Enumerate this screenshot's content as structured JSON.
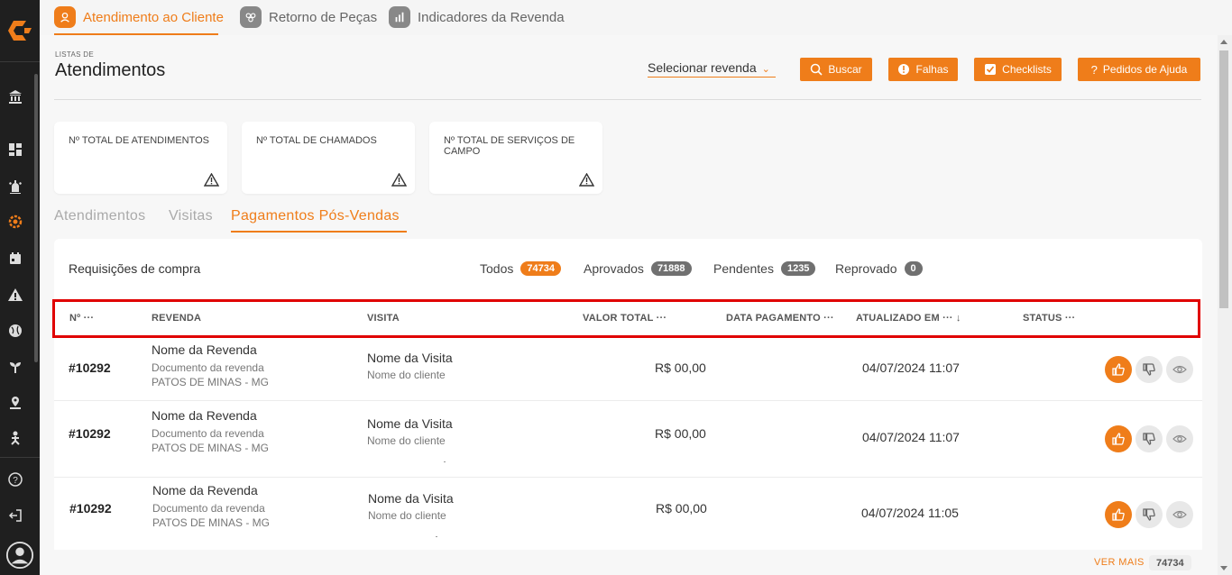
{
  "colors": {
    "accent": "#ef7d1a",
    "sidebar": "#1f1f1f",
    "highlight": "#e00000"
  },
  "top_tabs": [
    {
      "label": "Atendimento ao Cliente",
      "icon": "customer-service-icon",
      "active": true
    },
    {
      "label": "Retorno de Peças",
      "icon": "parts-return-icon",
      "active": false
    },
    {
      "label": "Indicadores da Revenda",
      "icon": "bar-chart-icon",
      "active": false
    }
  ],
  "header": {
    "sup_label": "LISTAS DE",
    "title": "Atendimentos",
    "select_placeholder": "Selecionar revenda"
  },
  "buttons": {
    "buscar": "Buscar",
    "falhas": "Falhas",
    "checklists": "Checklists",
    "ajuda": "Pedidos de Ajuda"
  },
  "cards": [
    {
      "label": "Nº TOTAL DE ATENDIMENTOS"
    },
    {
      "label": "Nº TOTAL DE CHAMADOS"
    },
    {
      "label": "Nº TOTAL DE SERVIÇOS DE CAMPO"
    }
  ],
  "section_tabs": [
    "Atendimentos",
    "Visitas",
    "Pagamentos Pós-Vendas"
  ],
  "panel": {
    "title": "Requisições de compra",
    "filters": [
      {
        "label": "Todos",
        "count": "74734"
      },
      {
        "label": "Aprovados",
        "count": "71888"
      },
      {
        "label": "Pendentes",
        "count": "1235"
      },
      {
        "label": "Reprovado",
        "count": "0"
      }
    ]
  },
  "table": {
    "headers": [
      "Nº ···",
      "REVENDA",
      "VISITA",
      "VALOR TOTAL ···",
      "DATA PAGAMENTO ···",
      "ATUALIZADO EM ··· ↓",
      "STATUS ···"
    ],
    "rows": [
      {
        "num": "#10292",
        "revenda": "Nome da Revenda",
        "doc": "Documento da revenda",
        "local": "PATOS DE MINAS - MG",
        "visita": "Nome da Visita",
        "cliente": "Nome do cliente",
        "valor": "R$ 00,00",
        "atualizado": "04/07/2024 11:07"
      },
      {
        "num": "#10292",
        "revenda": "Nome da Revenda",
        "doc": "Documento da revenda",
        "local": "PATOS DE MINAS - MG",
        "visita": "Nome da Visita",
        "cliente": "Nome do cliente",
        "valor": "R$ 00,00",
        "atualizado": "04/07/2024 11:07"
      },
      {
        "num": "#10292",
        "revenda": "Nome da Revenda",
        "doc": "Documento da revenda",
        "local": "PATOS DE MINAS - MG",
        "visita": "Nome da Visita",
        "cliente": "Nome do cliente",
        "valor": "R$ 00,00",
        "atualizado": "04/07/2024 11:05"
      }
    ]
  },
  "footer": {
    "ver_mais": "VER MAIS",
    "total": "74734"
  }
}
